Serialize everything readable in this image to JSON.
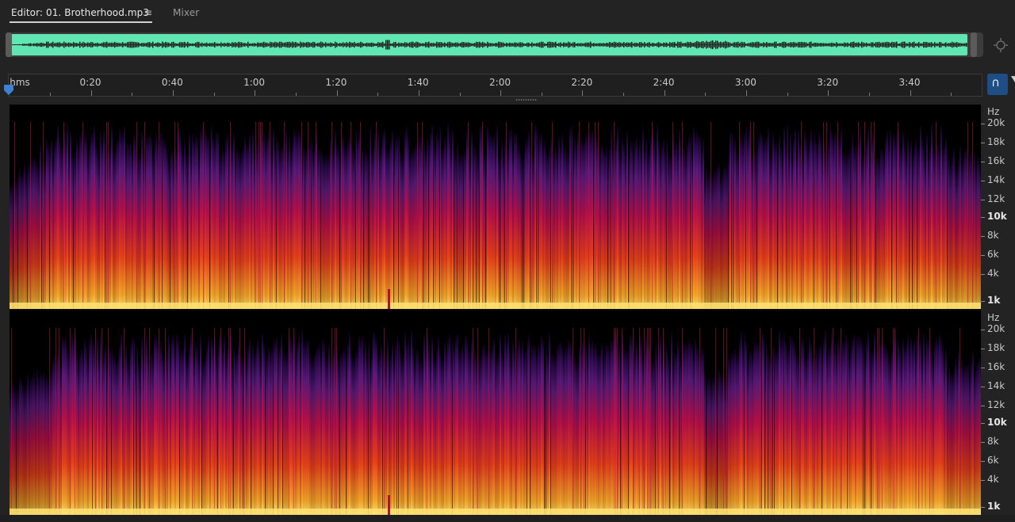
{
  "tabs": {
    "editor_label": "Editor: 01. Brotherhood.mp3",
    "menu_glyph": "≡",
    "mixer_label": "Mixer"
  },
  "overview": {
    "waveform_color": "#5fe6b2",
    "zoom_icon": "zoom-navigator-icon"
  },
  "timeline": {
    "unit_label": "hms",
    "ticks": [
      "0:20",
      "0:40",
      "1:00",
      "1:20",
      "1:40",
      "2:00",
      "2:20",
      "2:40",
      "3:00",
      "3:20",
      "3:40"
    ],
    "snap_icon": "magnet-icon",
    "snap_color": "#1f4d86"
  },
  "frequency_axis": {
    "unit_label": "Hz",
    "labels": [
      "20k",
      "18k",
      "16k",
      "14k",
      "12k",
      "10k",
      "8k",
      "6k",
      "4k",
      "1k"
    ]
  },
  "spectrogram": {
    "channels": 2,
    "palette": [
      "#000000",
      "#2a0a4a",
      "#5a1a7a",
      "#b8104a",
      "#e4301a",
      "#f07a1a",
      "#ffd860"
    ]
  }
}
